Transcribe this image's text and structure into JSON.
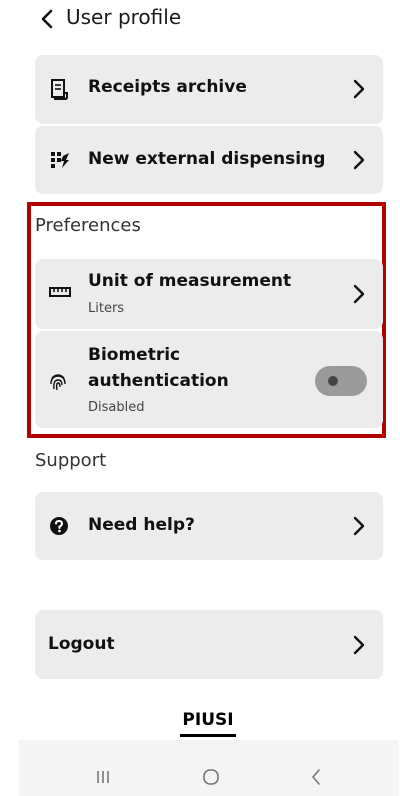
{
  "header": {
    "title": "User profile",
    "back_icon": "chevron-left-icon"
  },
  "menu": {
    "receipts_label": "Receipts archive",
    "external_label": "New external dispensing"
  },
  "preferences": {
    "section_title": "Preferences",
    "unit": {
      "label": "Unit of measurement",
      "value": "Liters"
    },
    "biometric": {
      "label_line1": "Biometric",
      "label_line2": "authentication",
      "status": "Disabled",
      "enabled": false
    }
  },
  "support": {
    "section_title": "Support",
    "help_label": "Need help?"
  },
  "logout_label": "Logout",
  "brand": {
    "logo_text": "PIUSI"
  },
  "colors": {
    "highlight_border": "#b00000",
    "card_bg": "#ececec",
    "toggle_off": "#9a9a9a"
  }
}
